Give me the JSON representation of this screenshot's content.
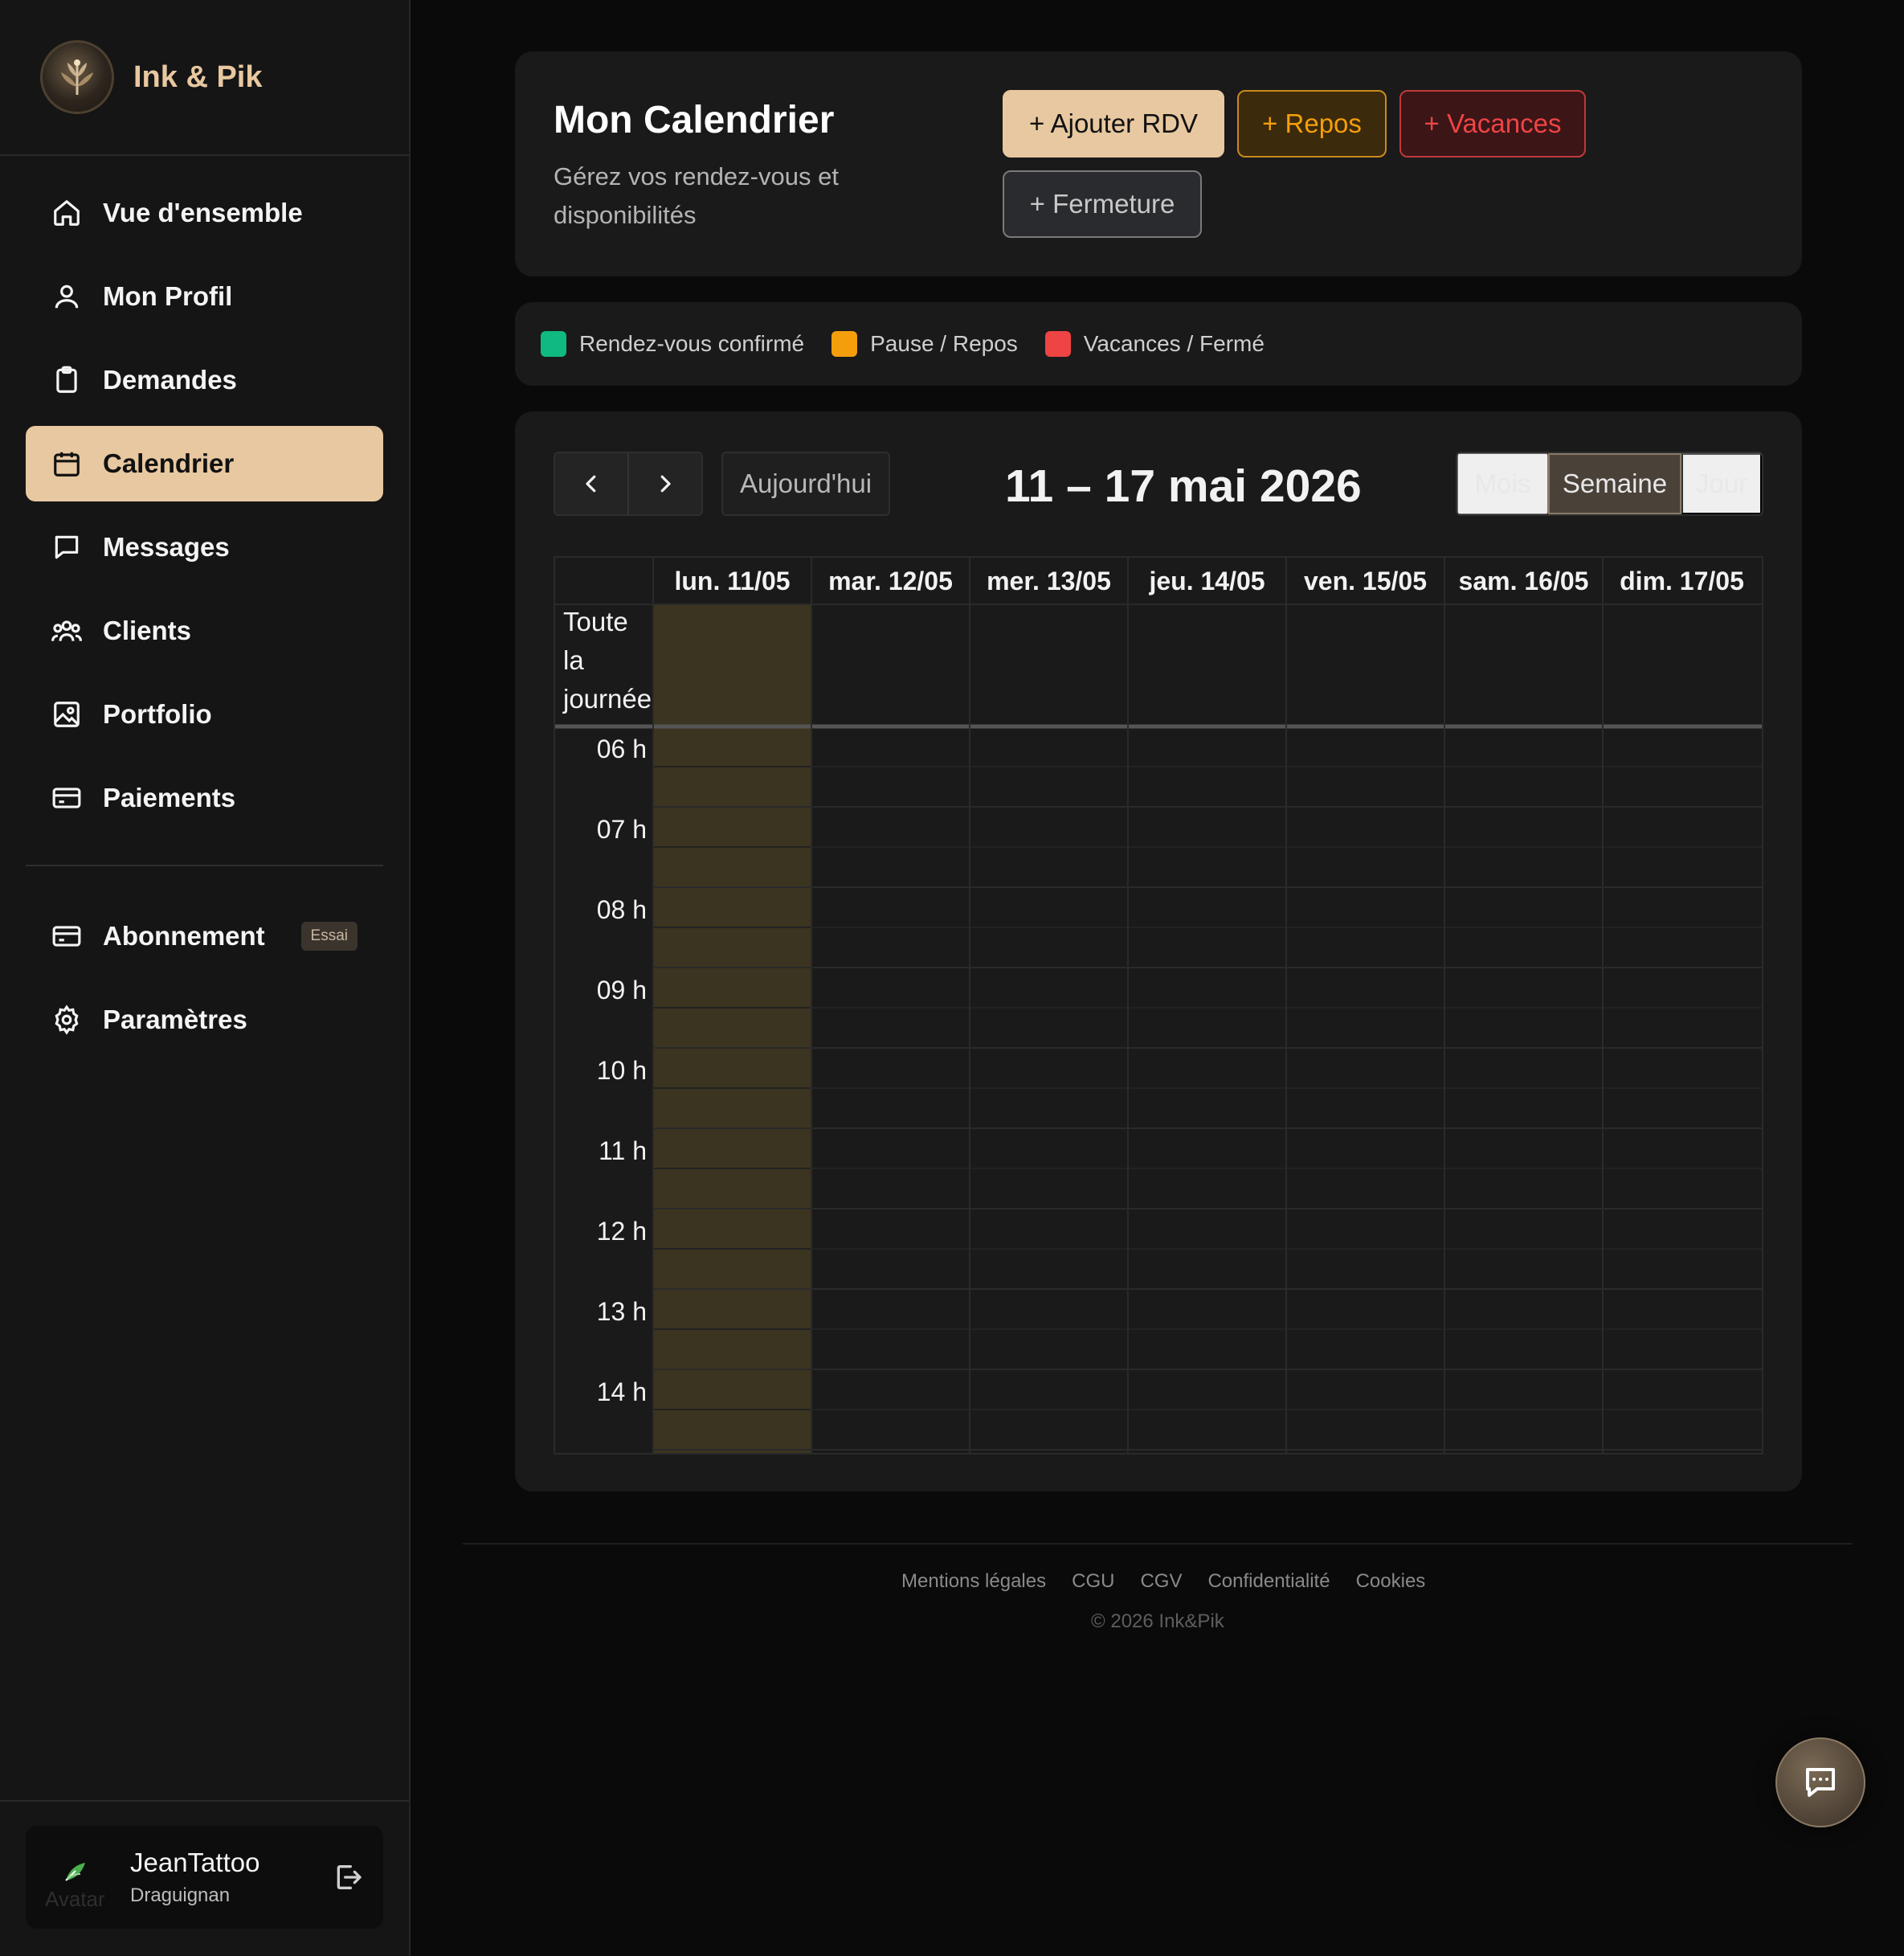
{
  "brand": {
    "name": "Ink & Pik"
  },
  "sidebar": {
    "items": [
      {
        "label": "Vue d'ensemble",
        "icon": "home-icon"
      },
      {
        "label": "Mon Profil",
        "icon": "user-icon"
      },
      {
        "label": "Demandes",
        "icon": "clipboard-icon"
      },
      {
        "label": "Calendrier",
        "icon": "calendar-icon",
        "active": true
      },
      {
        "label": "Messages",
        "icon": "message-icon"
      },
      {
        "label": "Clients",
        "icon": "users-icon"
      },
      {
        "label": "Portfolio",
        "icon": "image-icon"
      },
      {
        "label": "Paiements",
        "icon": "card-icon"
      }
    ],
    "secondary": [
      {
        "label": "Abonnement",
        "icon": "card-icon",
        "badge": "Essai"
      },
      {
        "label": "Paramètres",
        "icon": "gear-icon"
      }
    ],
    "user": {
      "name": "JeanTattoo",
      "city": "Draguignan",
      "avatar_alt": "Avatar"
    }
  },
  "header": {
    "title": "Mon Calendrier",
    "subtitle": "Gérez vos rendez-vous et disponibilités",
    "buttons": {
      "add_rdv": "+ Ajouter RDV",
      "repos": "+ Repos",
      "vacances": "+ Vacances",
      "fermeture": "+ Fermeture"
    }
  },
  "legend": [
    {
      "label": "Rendez-vous confirmé",
      "color": "#10b981"
    },
    {
      "label": "Pause / Repos",
      "color": "#f59e0b"
    },
    {
      "label": "Vacances / Fermé",
      "color": "#ef4444"
    }
  ],
  "calendar": {
    "today_label": "Aujourd'hui",
    "range_title": "11 – 17 mai 2026",
    "views": [
      "Mois",
      "Semaine",
      "Jour"
    ],
    "active_view": "Semaine",
    "allday_label": "Toute la journée",
    "days": [
      "lun. 11/05",
      "mar. 12/05",
      "mer. 13/05",
      "jeu. 14/05",
      "ven. 15/05",
      "sam. 16/05",
      "dim. 17/05"
    ],
    "today_index": 0,
    "today_color": "#3b3420",
    "hours": [
      "06 h",
      "07 h",
      "08 h",
      "09 h",
      "10 h",
      "11 h",
      "12 h",
      "13 h",
      "14 h"
    ]
  },
  "footer": {
    "links": [
      "Mentions légales",
      "CGU",
      "CGV",
      "Confidentialité",
      "Cookies"
    ],
    "copyright": "© 2026 Ink&Pik"
  }
}
